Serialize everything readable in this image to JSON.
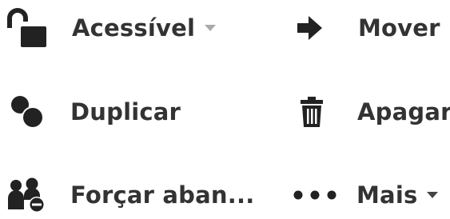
{
  "menu": {
    "items": [
      {
        "id": "acessivel",
        "label": "Acessível",
        "icon": "unlocked-padlock-icon",
        "has_dropdown": true
      },
      {
        "id": "mover",
        "label": "Mover",
        "icon": "arrow-right-icon",
        "has_dropdown": false
      },
      {
        "id": "duplicar",
        "label": "Duplicar",
        "icon": "duplicate-circles-icon",
        "has_dropdown": false
      },
      {
        "id": "apagar",
        "label": "Apagar",
        "icon": "trash-icon",
        "has_dropdown": false
      },
      {
        "id": "forcar",
        "label": "Forçar aban...",
        "icon": "users-remove-icon",
        "has_dropdown": false
      },
      {
        "id": "mais",
        "label": "Mais",
        "icon": "more-dots-icon",
        "has_dropdown": true
      }
    ]
  },
  "colors": {
    "text": "#333333",
    "icon": "#222222",
    "caret_muted": "#aaaaaa",
    "caret_dark": "#444444",
    "background": "#ffffff"
  }
}
